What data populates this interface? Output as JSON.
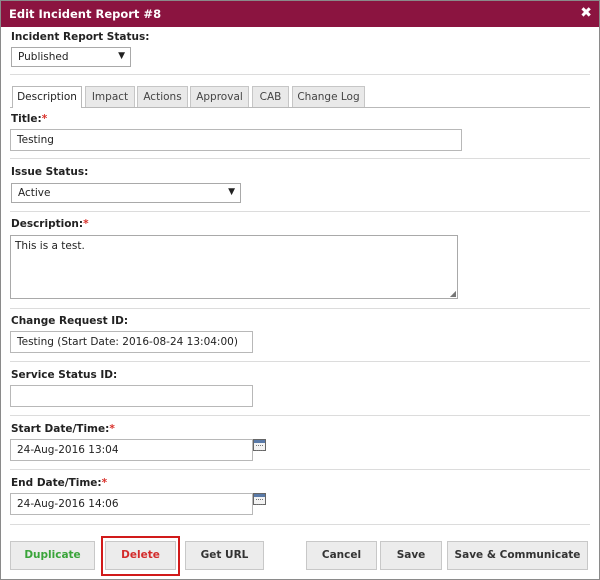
{
  "dialog": {
    "title": "Edit Incident Report #8",
    "close_glyph": "✖"
  },
  "report_status": {
    "label": "Incident Report Status:",
    "value": "Published"
  },
  "tabs": [
    {
      "label": "Description",
      "active": true
    },
    {
      "label": "Impact"
    },
    {
      "label": "Actions"
    },
    {
      "label": "Approval"
    },
    {
      "label": "CAB"
    },
    {
      "label": "Change Log"
    }
  ],
  "fields": {
    "title": {
      "label": "Title:",
      "required": "*",
      "value": "Testing"
    },
    "issue_status": {
      "label": "Issue Status:",
      "value": "Active"
    },
    "description": {
      "label": "Description:",
      "required": "*",
      "value": "This is a test."
    },
    "change_request": {
      "label": "Change Request ID:",
      "value": "Testing (Start Date: 2016-08-24 13:04:00)"
    },
    "service_status": {
      "label": "Service Status ID:",
      "value": ""
    },
    "start": {
      "label": "Start Date/Time:",
      "required": "*",
      "value": "24-Aug-2016 13:04"
    },
    "end": {
      "label": "End Date/Time:",
      "required": "*",
      "value": "24-Aug-2016 14:06"
    }
  },
  "buttons": {
    "duplicate": "Duplicate",
    "delete": "Delete",
    "get_url": "Get URL",
    "cancel": "Cancel",
    "save": "Save",
    "save_communicate": "Save & Communicate"
  },
  "colors": {
    "titlebar": "#8b1440",
    "required": "#d9302a",
    "duplicate_text": "#3aa43a",
    "delete_text": "#d32b2b",
    "highlight": "#d11a1a"
  },
  "icons": {
    "select_arrow": "▼",
    "calendar": "calendar-icon",
    "resize": "◢"
  }
}
